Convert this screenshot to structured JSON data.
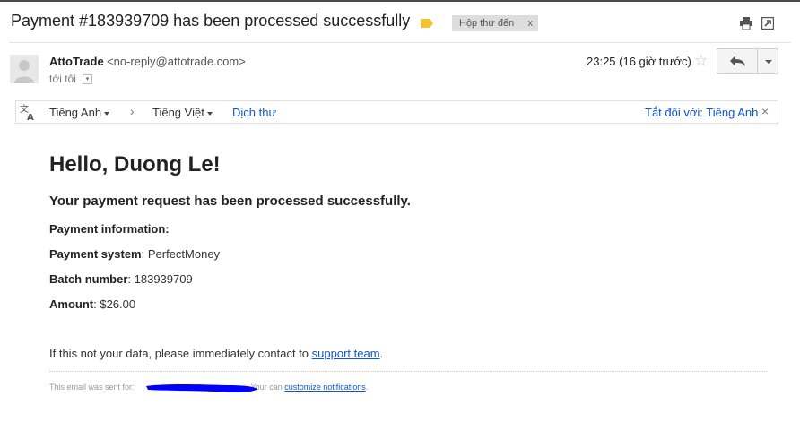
{
  "subject": "Payment #183939709 has been processed successfully",
  "label_chip": {
    "text": "Hộp thư đến",
    "close": "x"
  },
  "colors": {
    "label_tag": "#f4c430",
    "link": "#1155cc",
    "redaction": "#0000ff"
  },
  "sender": {
    "name": "AttoTrade",
    "email": "<no-reply@attotrade.com>",
    "to": "tới tôi",
    "time": "23:25 (16 giờ trước)"
  },
  "translate": {
    "from": "Tiếng Anh",
    "arrow": "›",
    "to": "Tiếng Việt",
    "action": "Dịch thư",
    "turn_off": "Tắt đối với: Tiếng Anh",
    "close": "×"
  },
  "body": {
    "greeting": "Hello, Duong Le!",
    "processed": "Your payment request has been processed successfully.",
    "info_heading": "Payment information:",
    "system_label": "Payment system",
    "system_value": ": PerfectMoney",
    "batch_label": "Batch number",
    "batch_value": ": 183939709",
    "amount_label": "Amount",
    "amount_value": ": $26.00",
    "warning_text": "If this not your data, please immediately contact to ",
    "support_link": "support team",
    "warning_end": "."
  },
  "footer": {
    "sent_for": "This email was sent for:",
    "you_can": "Your can",
    "customize": "customize notifications",
    "end": "."
  },
  "icons": [
    "print-icon",
    "popout-icon",
    "avatar-icon",
    "star-icon",
    "reply-icon",
    "translate-icon"
  ]
}
